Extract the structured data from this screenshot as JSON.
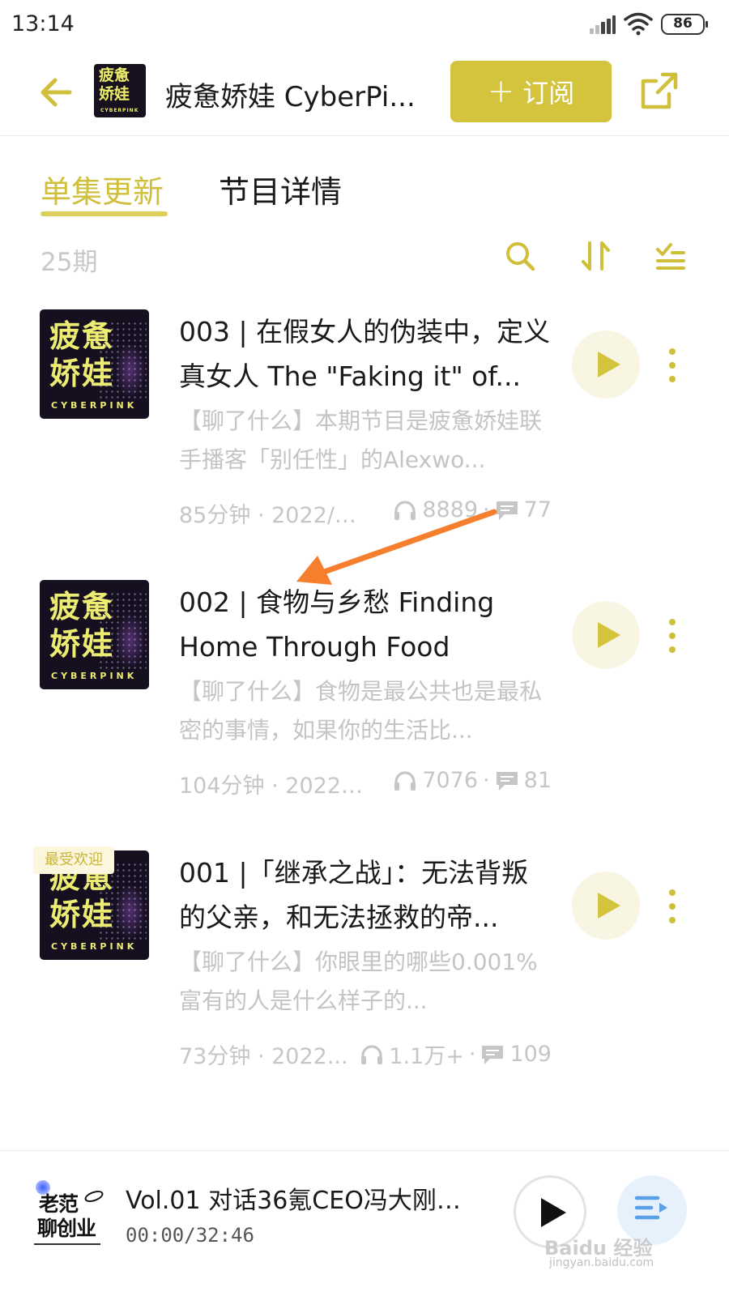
{
  "status_bar": {
    "time": "13:14",
    "battery": "86"
  },
  "header": {
    "podcast_title": "疲惫娇娃 CyberPi...",
    "cover_text_line1": "疲惫",
    "cover_text_line2": "娇娃",
    "cover_text_sub": "CYBERPINK",
    "subscribe_label": "订阅",
    "subscribe_plus": "+"
  },
  "tabs": [
    {
      "label": "单集更新",
      "active": true
    },
    {
      "label": "节目详情",
      "active": false
    }
  ],
  "episode_count": "25期",
  "cover": {
    "line1": "疲惫",
    "line2": "娇娃",
    "sub": "CYBERPINK"
  },
  "episodes": [
    {
      "title": "003 | 在假女人的伪装中，定义真女人 The \"Faking it\" of...",
      "desc": "【聊了什么】本期节目是疲惫娇娃联手播客「别任性」的Alexwo...",
      "duration_date": "85分钟 · 2022/0...",
      "plays": "8889",
      "comments": "77"
    },
    {
      "title": "002 | 食物与乡愁 Finding Home Through Food",
      "desc": "【聊了什么】食物是最公共也是最私密的事情，如果你的生活比...",
      "duration_date": "104分钟 · 2022/...",
      "plays": "7076",
      "comments": "81"
    },
    {
      "title": "001 |「继承之战」：无法背叛的父亲，和无法拯救的帝...",
      "desc": "【聊了什么】你眼里的哪些0.001%富有的人是什么样子的...",
      "duration_date": "73分钟 · 2022...",
      "plays": "1.1万+",
      "comments": "109",
      "badge": "最受欢迎"
    }
  ],
  "player": {
    "logo_line1": "老范",
    "logo_line2": "聊创业",
    "title": "Vol.01 对话36氪CEO冯大刚：...",
    "time": "00:00/32:46"
  },
  "watermark": {
    "line1": "Baidu 经验",
    "line2": "jingyan.baidu.com"
  },
  "colors": {
    "accent": "#d4c33c",
    "accent_text": "#cfbf3a",
    "annotation_arrow": "#f57f2d",
    "muted_text": "#c4c4c4"
  }
}
